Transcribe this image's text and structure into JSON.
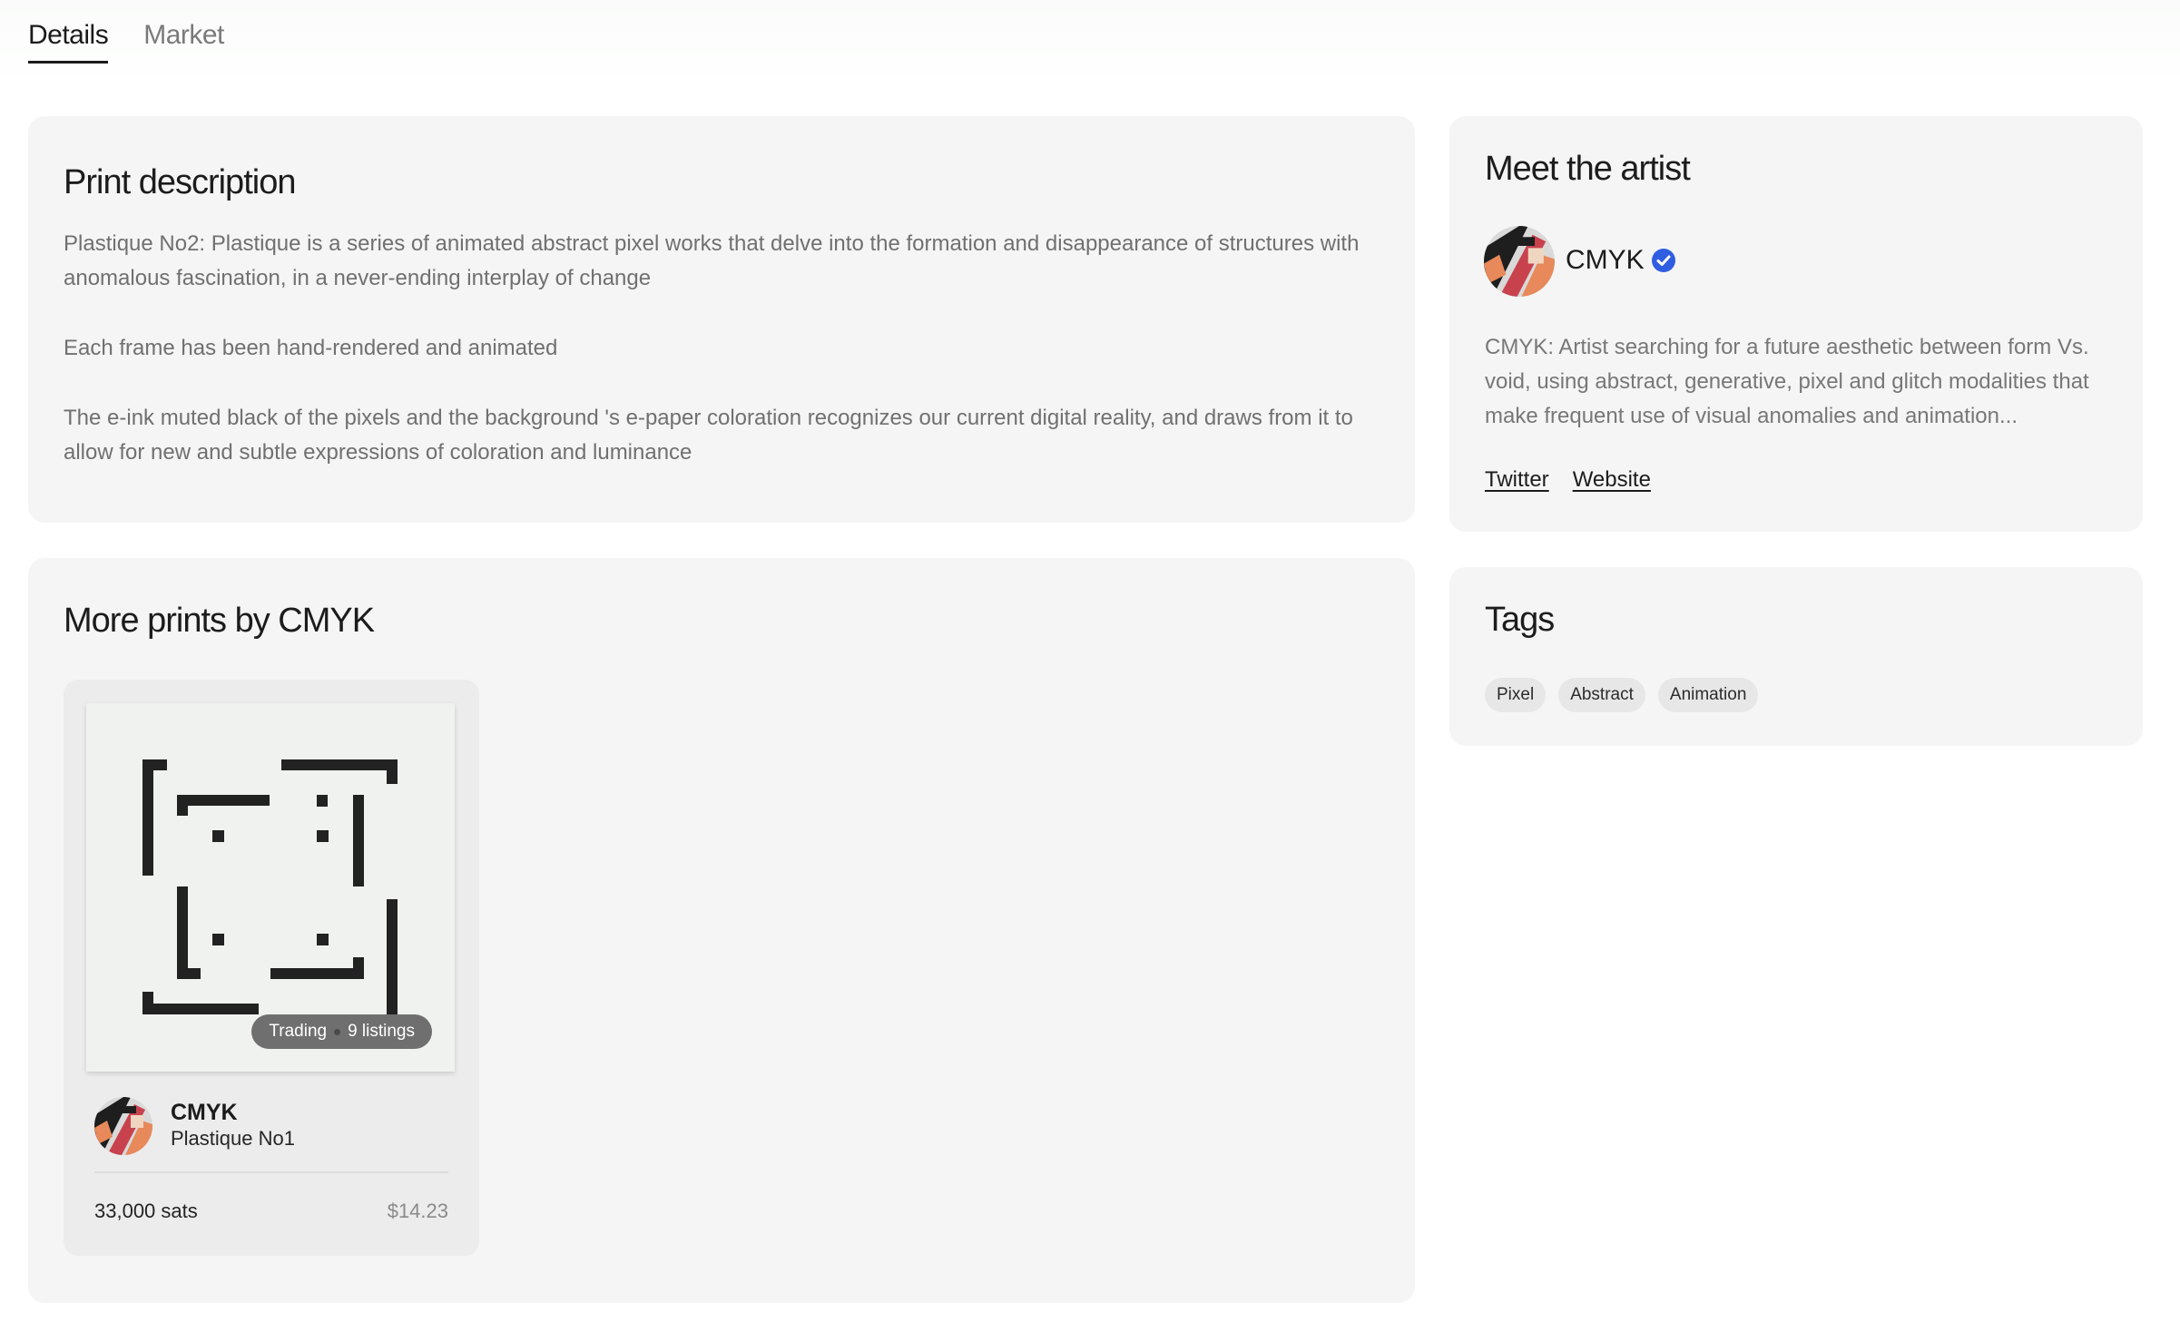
{
  "tabs": [
    {
      "label": "Details",
      "active": true
    },
    {
      "label": "Market",
      "active": false
    }
  ],
  "description": {
    "heading": "Print description",
    "paragraphs": [
      "Plastique No2: Plastique is a series of animated abstract pixel works that delve into the formation and disappearance of structures with anomalous fascination, in a never-ending interplay of change",
      "Each frame has been hand-rendered and animated",
      "The e-ink muted black of the pixels and the background 's e-paper coloration recognizes our current digital reality, and draws from it to allow for new and subtle expressions of coloration and luminance"
    ]
  },
  "more_prints": {
    "heading": "More prints by CMYK",
    "items": [
      {
        "status": "Trading",
        "listings": "9 listings",
        "artist": "CMYK",
        "title": "Plastique No1",
        "price": "33,000 sats",
        "usd": "$14.23"
      }
    ]
  },
  "artist": {
    "heading": "Meet the artist",
    "name": "CMYK",
    "verified": true,
    "bio": "CMYK: Artist searching for a future aesthetic between form Vs. void, using abstract, generative, pixel and glitch modalities that make frequent use of visual anomalies and animation...",
    "links": [
      "Twitter",
      "Website"
    ]
  },
  "tags": {
    "heading": "Tags",
    "items": [
      "Pixel",
      "Abstract",
      "Animation"
    ]
  },
  "colors": {
    "card_bg": "#f5f5f5",
    "verified": "#2f5fe0",
    "avatar_red": "#c8424e",
    "avatar_orange": "#e7895a",
    "avatar_dark": "#1e1e1e"
  },
  "icons": {
    "verified": "verified-badge-icon",
    "avatar": "artist-avatar-icon"
  }
}
